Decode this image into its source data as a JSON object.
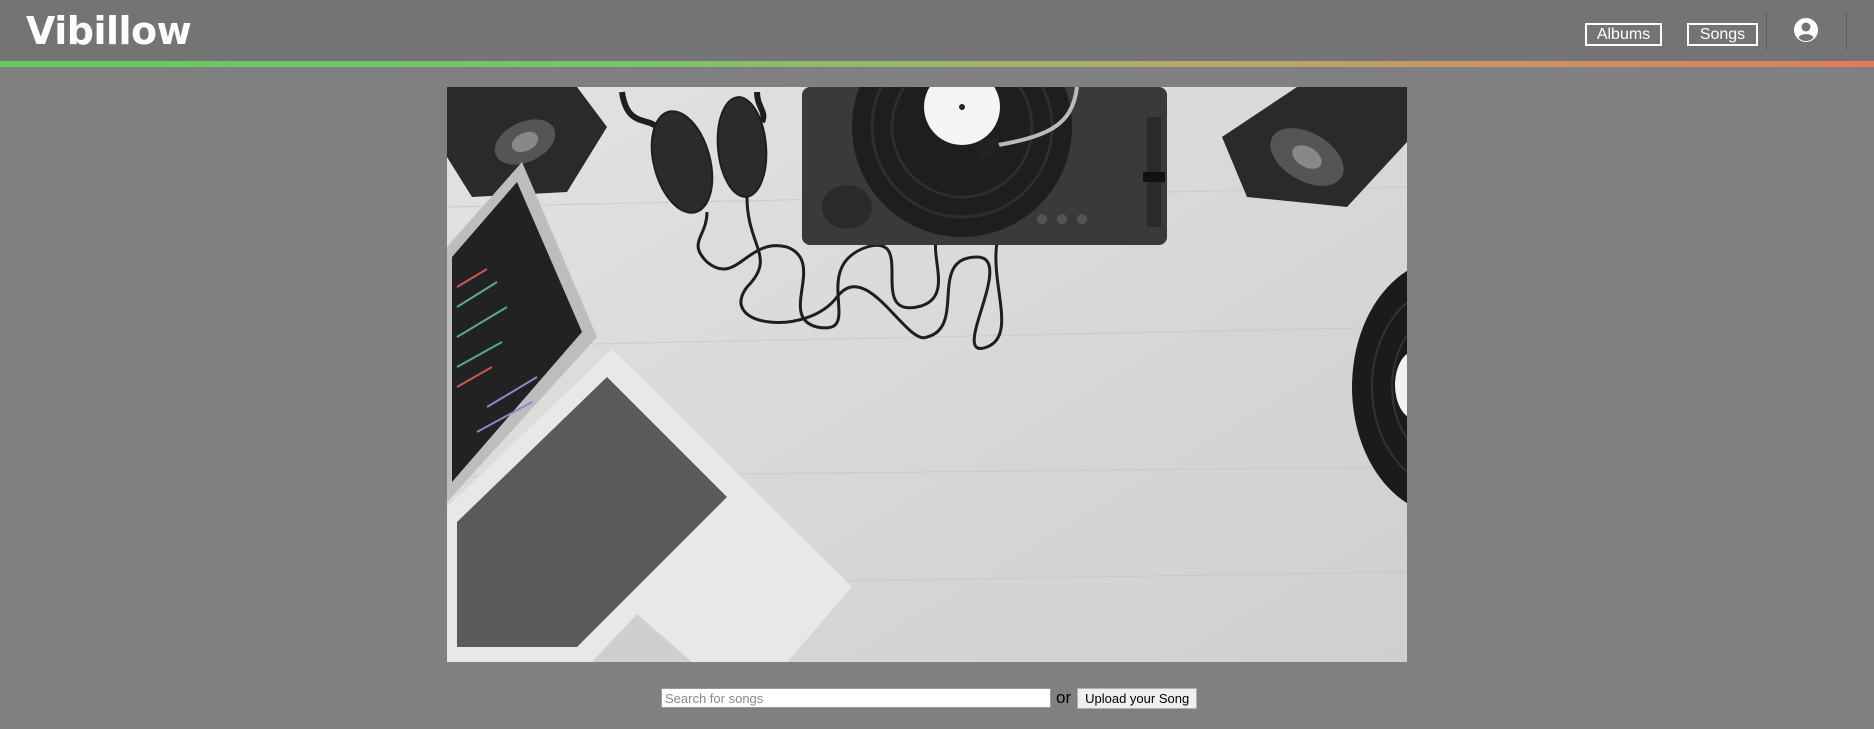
{
  "brand": {
    "name": "Vibillow"
  },
  "nav": {
    "albums_label": "Albums",
    "songs_label": "Songs",
    "user_icon": "user-circle-icon"
  },
  "hero": {
    "description_icon": "music-workspace-photo"
  },
  "search": {
    "placeholder": "Search for songs",
    "value": ""
  },
  "separator_text": "or",
  "upload": {
    "label": "Upload your Song"
  },
  "colors": {
    "background": "#808080",
    "navbar": "#747474",
    "gradient_start": "#5fcf5f",
    "gradient_end": "#e07c5a",
    "text_light": "#ffffff"
  }
}
